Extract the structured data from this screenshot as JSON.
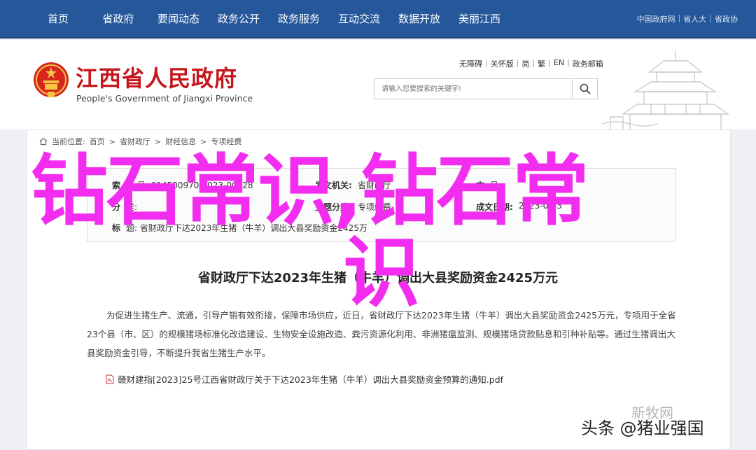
{
  "topnav": {
    "items": [
      "首页",
      "省政府",
      "要闻动态",
      "政务公开",
      "政务服务",
      "互动交流",
      "数据开放",
      "美丽江西"
    ],
    "links": [
      "中国政府网",
      "省人大",
      "省政协"
    ]
  },
  "header": {
    "title": "江西省人民政府",
    "subtitle": "People's Government of Jiangxi Province",
    "util_links": [
      "无障碍",
      "关怀版",
      "简",
      "繁",
      "EN",
      "政务邮箱"
    ],
    "search_placeholder": "请输入您要搜索的关键字!"
  },
  "breadcrumb": {
    "label": "当前位置:",
    "items": [
      "首页",
      "省财政厅",
      "财经信息",
      "专项经费"
    ]
  },
  "info": {
    "row1_k1": "索",
    "row1_v1": "引 号: 014500970/2023-00328",
    "row1_k2": "发文机关:",
    "row1_v2": "省财政厅",
    "row1_k3": "文",
    "row1_v3": "号:",
    "row2_k1": "分",
    "row2_v1": "类:",
    "row2_k2": "主题分类:",
    "row2_v2": "专项经费",
    "row2_k3": "成文日期:",
    "row2_v3": "2023-05-3",
    "row3_k1": "标",
    "row3_v1": "题: 省财政厅下达2023年生猪（牛羊）调出大县奖励资金2425万"
  },
  "article": {
    "title": "省财政厅下达2023年生猪（牛羊）调出大县奖励资金2425万元",
    "paragraph": "为促进生猪生产、流通，引导产销有效衔接，保障市场供应，近日，省财政厅下达2023年生猪（牛羊）调出大县奖励资金2425万元，专项用于全省23个县（市、区）的规模猪场标准化改造建设、生物安全设施改造、粪污资源化利用、非洲猪瘟监测、规模猪场贷款贴息和引种补贴等。通过生猪调出大县奖励资金引导，不断提升我省生猪生产水平。",
    "attachment": "赣财建指[2023]25号江西省财政厅关于下达2023年生猪（牛羊）调出大县奖励资金预算的通知.pdf"
  },
  "overlay": {
    "line1": "钻石常识,钻石常",
    "line2": "识"
  },
  "watermark": {
    "top": "新牧网",
    "bottom": "头条 @猪业强国"
  },
  "colors": {
    "nav_bg": "#25579a",
    "brand_red": "#c6161d",
    "overlay_magenta": "#f22df0"
  }
}
